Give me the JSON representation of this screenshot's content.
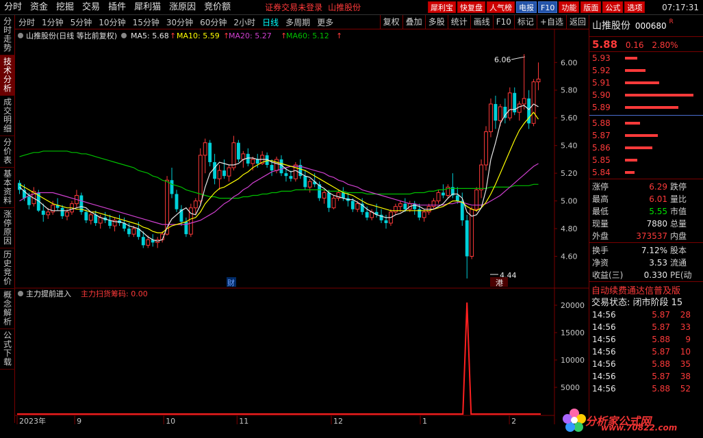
{
  "menu": [
    "分时",
    "资金",
    "挖掘",
    "交易",
    "插件",
    "犀利猫",
    "涨原因",
    "竞价额"
  ],
  "login_status": "证券交易未登录",
  "menu_stock": "山推股份",
  "top_buttons": [
    {
      "label": "犀利宝",
      "color": "red"
    },
    {
      "label": "快复盘",
      "color": "red"
    },
    {
      "label": "人气榜",
      "color": "red"
    },
    {
      "label": "电报",
      "color": "blue"
    },
    {
      "label": "F10",
      "color": "blue"
    },
    {
      "label": "功能",
      "color": "red"
    },
    {
      "label": "版面",
      "color": "red"
    },
    {
      "label": "公式",
      "color": "red"
    },
    {
      "label": "选项",
      "color": "red"
    }
  ],
  "clock": "07:17:31",
  "left_tabs": [
    "分时走势",
    "技术分析",
    "成交明细",
    "分价表",
    "基本资料",
    "涨停原因",
    "历史竞价",
    "概念解析",
    "公式下载"
  ],
  "active_left_tab": 1,
  "periods": [
    "分时",
    "1分钟",
    "5分钟",
    "10分钟",
    "15分钟",
    "30分钟",
    "60分钟",
    "2小时",
    "日线",
    "多周期",
    "更多"
  ],
  "active_period": 8,
  "tools": [
    "复权",
    "叠加",
    "多股",
    "统计",
    "画线",
    "F10",
    "标记",
    "+自选",
    "返回"
  ],
  "chart_header": {
    "title": "山推股份(日线 等比前复权)",
    "ma5": "MA5: 5.68",
    "ma10": "MA10: 5.59",
    "ma20": "MA20: 5.27",
    "ma60": "MA60: 5.12",
    "arrow": "↑"
  },
  "indicator_header": {
    "name": "主力提前进入",
    "sub": "主力扫货筹码: 0.00"
  },
  "annotations": {
    "high": "6.06",
    "low": "4.44",
    "marker1": "财",
    "marker2": "港"
  },
  "colors": {
    "up": "#ff3a3a",
    "down": "#00d0d8",
    "ma5": "#e8e8e8",
    "ma10": "#ffff00",
    "ma20": "#d040d0",
    "ma60": "#00c000",
    "frame": "#7a0000"
  },
  "chart_data": {
    "type": "candlestick",
    "price_axis": [
      "6.00",
      "5.80",
      "5.60",
      "5.40",
      "5.20",
      "5.00",
      "4.80",
      "4.60"
    ],
    "price_range": [
      4.4,
      6.12
    ],
    "volume_axis": [
      "20000",
      "15000",
      "10000",
      "5000"
    ],
    "volume_range": [
      0,
      21000
    ],
    "x_labels": [
      "2023年",
      "9",
      "10",
      "11",
      "12",
      "1",
      "2"
    ],
    "candles": [
      [
        5.13,
        5.15,
        5.05,
        5.08
      ],
      [
        5.08,
        5.12,
        5.0,
        5.02
      ],
      [
        5.03,
        5.06,
        4.94,
        4.97
      ],
      [
        4.98,
        5.1,
        4.96,
        5.07
      ],
      [
        5.06,
        5.08,
        4.92,
        4.93
      ],
      [
        4.93,
        4.98,
        4.85,
        4.9
      ],
      [
        4.9,
        4.95,
        4.87,
        4.92
      ],
      [
        4.92,
        5.0,
        4.9,
        4.97
      ],
      [
        4.97,
        5.02,
        4.93,
        4.95
      ],
      [
        4.95,
        4.97,
        4.87,
        4.89
      ],
      [
        4.89,
        4.94,
        4.86,
        4.92
      ],
      [
        4.92,
        5.0,
        4.9,
        4.98
      ],
      [
        4.98,
        5.08,
        4.95,
        5.04
      ],
      [
        5.04,
        5.06,
        4.9,
        4.92
      ],
      [
        4.92,
        4.94,
        4.84,
        4.86
      ],
      [
        4.86,
        4.92,
        4.83,
        4.9
      ],
      [
        4.9,
        4.93,
        4.82,
        4.84
      ],
      [
        4.84,
        4.9,
        4.8,
        4.88
      ],
      [
        4.88,
        4.92,
        4.84,
        4.86
      ],
      [
        4.86,
        4.9,
        4.8,
        4.82
      ],
      [
        4.82,
        4.88,
        4.78,
        4.86
      ],
      [
        4.86,
        4.9,
        4.82,
        4.84
      ],
      [
        4.84,
        4.88,
        4.78,
        4.8
      ],
      [
        4.8,
        4.84,
        4.74,
        4.76
      ],
      [
        4.76,
        4.82,
        4.74,
        4.8
      ],
      [
        4.8,
        4.85,
        4.72,
        4.74
      ],
      [
        4.74,
        4.78,
        4.66,
        4.68
      ],
      [
        4.68,
        4.75,
        4.66,
        4.72
      ],
      [
        4.72,
        4.76,
        4.67,
        4.7
      ],
      [
        4.7,
        4.74,
        4.66,
        4.72
      ],
      [
        4.72,
        4.78,
        4.7,
        4.76
      ],
      [
        4.76,
        5.18,
        4.75,
        5.15
      ],
      [
        5.15,
        5.24,
        5.02,
        5.05
      ],
      [
        5.05,
        5.08,
        4.92,
        4.94
      ],
      [
        4.94,
        4.97,
        4.82,
        4.85
      ],
      [
        4.85,
        4.88,
        4.74,
        4.76
      ],
      [
        4.76,
        4.98,
        4.74,
        4.95
      ],
      [
        4.95,
        5.02,
        4.9,
        5.0
      ],
      [
        5.0,
        5.38,
        4.98,
        5.33
      ],
      [
        5.33,
        5.45,
        5.2,
        5.42
      ],
      [
        5.42,
        5.44,
        5.25,
        5.28
      ],
      [
        5.28,
        5.34,
        5.12,
        5.16
      ],
      [
        5.16,
        5.26,
        5.08,
        5.22
      ],
      [
        5.22,
        5.3,
        5.16,
        5.18
      ],
      [
        5.18,
        5.26,
        5.14,
        5.24
      ],
      [
        5.24,
        5.47,
        5.22,
        5.42
      ],
      [
        5.42,
        5.44,
        5.28,
        5.3
      ],
      [
        5.3,
        5.36,
        5.24,
        5.34
      ],
      [
        5.34,
        5.38,
        5.25,
        5.27
      ],
      [
        5.27,
        5.32,
        5.22,
        5.3
      ],
      [
        5.3,
        5.34,
        5.24,
        5.27
      ],
      [
        5.27,
        5.36,
        5.26,
        5.33
      ],
      [
        5.33,
        5.35,
        5.24,
        5.26
      ],
      [
        5.26,
        5.3,
        5.18,
        5.22
      ],
      [
        5.22,
        5.32,
        5.2,
        5.3
      ],
      [
        5.3,
        5.33,
        5.18,
        5.2
      ],
      [
        5.2,
        5.24,
        5.14,
        5.18
      ],
      [
        5.18,
        5.22,
        5.14,
        5.16
      ],
      [
        5.16,
        5.28,
        5.14,
        5.26
      ],
      [
        5.26,
        5.3,
        5.16,
        5.18
      ],
      [
        5.18,
        5.22,
        5.08,
        5.1
      ],
      [
        5.1,
        5.16,
        5.06,
        5.14
      ],
      [
        5.14,
        5.2,
        5.1,
        5.12
      ],
      [
        5.12,
        5.14,
        5.0,
        5.02
      ],
      [
        5.02,
        5.08,
        4.98,
        5.06
      ],
      [
        5.06,
        5.08,
        4.92,
        4.95
      ],
      [
        4.95,
        5.04,
        4.94,
        5.02
      ],
      [
        5.02,
        5.08,
        5.0,
        5.06
      ],
      [
        5.06,
        5.1,
        5.0,
        5.02
      ],
      [
        5.02,
        5.06,
        4.96,
        5.0
      ],
      [
        5.0,
        5.02,
        4.92,
        4.94
      ],
      [
        4.94,
        5.0,
        4.92,
        4.98
      ],
      [
        4.98,
        5.02,
        4.9,
        4.92
      ],
      [
        4.92,
        4.96,
        4.86,
        4.88
      ],
      [
        4.88,
        4.94,
        4.86,
        4.92
      ],
      [
        4.92,
        4.98,
        4.88,
        4.9
      ],
      [
        4.9,
        4.94,
        4.84,
        4.86
      ],
      [
        4.86,
        4.9,
        4.8,
        4.84
      ],
      [
        4.84,
        4.94,
        4.82,
        4.92
      ],
      [
        4.92,
        4.98,
        4.9,
        4.96
      ],
      [
        4.96,
        5.0,
        4.92,
        4.98
      ],
      [
        4.98,
        5.02,
        4.92,
        4.94
      ],
      [
        4.94,
        5.0,
        4.92,
        4.98
      ],
      [
        4.98,
        5.0,
        4.9,
        4.94
      ],
      [
        4.94,
        4.98,
        4.86,
        4.88
      ],
      [
        4.88,
        4.94,
        4.85,
        4.92
      ],
      [
        4.92,
        4.98,
        4.9,
        4.96
      ],
      [
        4.96,
        5.02,
        4.94,
        5.0
      ],
      [
        5.0,
        5.08,
        4.98,
        5.06
      ],
      [
        5.06,
        5.12,
        5.02,
        5.04
      ],
      [
        5.04,
        5.12,
        5.02,
        5.1
      ],
      [
        5.1,
        5.2,
        5.02,
        5.04
      ],
      [
        5.04,
        5.1,
        4.98,
        5.0
      ],
      [
        5.0,
        5.06,
        4.82,
        4.86
      ],
      [
        4.86,
        4.9,
        4.44,
        4.6
      ],
      [
        4.6,
        4.96,
        4.58,
        4.94
      ],
      [
        4.94,
        5.1,
        4.92,
        5.08
      ],
      [
        5.08,
        5.3,
        5.02,
        5.26
      ],
      [
        5.26,
        5.54,
        5.22,
        5.5
      ],
      [
        5.5,
        5.74,
        5.46,
        5.7
      ],
      [
        5.7,
        5.76,
        5.52,
        5.58
      ],
      [
        5.58,
        5.7,
        5.54,
        5.68
      ],
      [
        5.68,
        5.74,
        5.56,
        5.6
      ],
      [
        5.6,
        5.82,
        5.58,
        5.78
      ],
      [
        5.78,
        5.82,
        5.62,
        5.64
      ],
      [
        5.64,
        5.72,
        5.58,
        5.7
      ],
      [
        5.7,
        6.06,
        5.66,
        5.74
      ],
      [
        5.74,
        5.8,
        5.52,
        5.56
      ],
      [
        5.56,
        5.88,
        5.54,
        5.86
      ],
      [
        5.86,
        6.0,
        5.8,
        5.88
      ]
    ],
    "ma5": [
      5.1,
      5.07,
      5.04,
      5.02,
      5.0,
      4.97,
      4.94,
      4.93,
      4.93,
      4.93,
      4.93,
      4.94,
      4.95,
      4.96,
      4.95,
      4.92,
      4.9,
      4.88,
      4.87,
      4.86,
      4.85,
      4.85,
      4.84,
      4.82,
      4.81,
      4.8,
      4.77,
      4.74,
      4.72,
      4.71,
      4.72,
      4.81,
      4.87,
      4.9,
      4.93,
      4.95,
      4.91,
      4.9,
      4.97,
      5.1,
      5.2,
      5.24,
      5.28,
      5.27,
      5.26,
      5.26,
      5.27,
      5.3,
      5.31,
      5.31,
      5.3,
      5.3,
      5.3,
      5.28,
      5.27,
      5.26,
      5.23,
      5.21,
      5.22,
      5.2,
      5.18,
      5.17,
      5.14,
      5.11,
      5.09,
      5.06,
      5.04,
      5.03,
      5.02,
      5.01,
      5.01,
      4.99,
      4.97,
      4.94,
      4.92,
      4.9,
      4.89,
      4.88,
      4.88,
      4.9,
      4.91,
      4.93,
      4.96,
      4.97,
      4.96,
      4.94,
      4.94,
      4.94,
      4.96,
      4.98,
      5.02,
      5.05,
      5.05,
      5.02,
      4.92,
      4.89,
      4.9,
      4.95,
      5.08,
      5.3,
      5.42,
      5.56,
      5.62,
      5.66,
      5.66,
      5.68,
      5.69,
      5.66,
      5.7,
      5.68
    ],
    "ma10": [
      5.12,
      5.1,
      5.08,
      5.06,
      5.04,
      5.02,
      5.0,
      4.98,
      4.97,
      4.96,
      4.95,
      4.95,
      4.94,
      4.94,
      4.93,
      4.92,
      4.92,
      4.91,
      4.9,
      4.89,
      4.88,
      4.87,
      4.86,
      4.85,
      4.84,
      4.83,
      4.81,
      4.8,
      4.78,
      4.77,
      4.77,
      4.8,
      4.82,
      4.83,
      4.84,
      4.85,
      4.87,
      4.88,
      4.92,
      4.98,
      5.02,
      5.06,
      5.09,
      5.1,
      5.12,
      5.14,
      5.16,
      5.19,
      5.21,
      5.24,
      5.26,
      5.28,
      5.29,
      5.29,
      5.28,
      5.27,
      5.26,
      5.25,
      5.24,
      5.23,
      5.22,
      5.2,
      5.18,
      5.16,
      5.14,
      5.12,
      5.1,
      5.08,
      5.06,
      5.05,
      5.04,
      5.02,
      5.0,
      4.98,
      4.97,
      4.96,
      4.95,
      4.94,
      4.93,
      4.93,
      4.93,
      4.93,
      4.93,
      4.93,
      4.93,
      4.93,
      4.93,
      4.94,
      4.95,
      4.96,
      4.98,
      5.0,
      5.0,
      4.99,
      4.96,
      4.94,
      4.93,
      4.95,
      4.99,
      5.05,
      5.12,
      5.2,
      5.28,
      5.36,
      5.44,
      5.51,
      5.56,
      5.6,
      5.64,
      5.59
    ],
    "ma20": [
      5.0,
      5.02,
      5.04,
      5.05,
      5.06,
      5.06,
      5.06,
      5.06,
      5.05,
      5.04,
      5.03,
      5.02,
      5.01,
      5.0,
      4.99,
      4.98,
      4.97,
      4.96,
      4.95,
      4.94,
      4.93,
      4.92,
      4.91,
      4.9,
      4.89,
      4.88,
      4.87,
      4.86,
      4.85,
      4.84,
      4.83,
      4.83,
      4.83,
      4.83,
      4.83,
      4.83,
      4.84,
      4.85,
      4.86,
      4.88,
      4.9,
      4.92,
      4.95,
      4.98,
      5.0,
      5.03,
      5.05,
      5.08,
      5.1,
      5.13,
      5.15,
      5.17,
      5.19,
      5.21,
      5.22,
      5.23,
      5.24,
      5.25,
      5.25,
      5.25,
      5.24,
      5.23,
      5.22,
      5.21,
      5.2,
      5.18,
      5.17,
      5.15,
      5.14,
      5.12,
      5.11,
      5.1,
      5.08,
      5.07,
      5.06,
      5.05,
      5.04,
      5.03,
      5.02,
      5.01,
      5.0,
      4.99,
      4.98,
      4.98,
      4.97,
      4.97,
      4.97,
      4.97,
      4.97,
      4.97,
      4.98,
      4.98,
      4.99,
      4.99,
      4.98,
      4.97,
      4.97,
      4.97,
      4.98,
      5.0,
      5.02,
      5.04,
      5.07,
      5.1,
      5.13,
      5.16,
      5.19,
      5.22,
      5.25,
      5.27
    ],
    "ma60": [
      5.32,
      5.33,
      5.34,
      5.35,
      5.35,
      5.36,
      5.36,
      5.36,
      5.36,
      5.36,
      5.36,
      5.35,
      5.35,
      5.34,
      5.34,
      5.33,
      5.32,
      5.31,
      5.3,
      5.29,
      5.28,
      5.27,
      5.26,
      5.25,
      5.24,
      5.22,
      5.21,
      5.2,
      5.18,
      5.17,
      5.15,
      5.14,
      5.12,
      5.11,
      5.1,
      5.08,
      5.07,
      5.06,
      5.05,
      5.04,
      5.03,
      5.03,
      5.02,
      5.02,
      5.02,
      5.02,
      5.02,
      5.03,
      5.03,
      5.04,
      5.04,
      5.05,
      5.05,
      5.06,
      5.06,
      5.07,
      5.07,
      5.07,
      5.08,
      5.08,
      5.08,
      5.08,
      5.08,
      5.08,
      5.08,
      5.07,
      5.07,
      5.07,
      5.07,
      5.06,
      5.06,
      5.06,
      5.06,
      5.05,
      5.05,
      5.05,
      5.05,
      5.05,
      5.05,
      5.05,
      5.05,
      5.05,
      5.05,
      5.06,
      5.06,
      5.06,
      5.07,
      5.07,
      5.08,
      5.08,
      5.09,
      5.09,
      5.09,
      5.09,
      5.09,
      5.09,
      5.09,
      5.09,
      5.09,
      5.1,
      5.1,
      5.1,
      5.1,
      5.1,
      5.11,
      5.11,
      5.11,
      5.11,
      5.12,
      5.12
    ],
    "volume_spike": {
      "index": 94,
      "value": 20500
    }
  },
  "stock": {
    "name": "山推股份",
    "code": "000680",
    "r": "R",
    "price": "5.88",
    "chg": "0.16",
    "pct": "2.80%"
  },
  "asks": [
    {
      "price": "5.93",
      "bar": 18
    },
    {
      "price": "5.92",
      "bar": 30
    },
    {
      "price": "5.91",
      "bar": 50
    },
    {
      "price": "5.90",
      "bar": 100
    },
    {
      "price": "5.89",
      "bar": 78
    }
  ],
  "bids": [
    {
      "price": "5.88",
      "bar": 22
    },
    {
      "price": "5.87",
      "bar": 48
    },
    {
      "price": "5.86",
      "bar": 40
    },
    {
      "price": "5.85",
      "bar": 18
    },
    {
      "price": "5.84",
      "bar": 14
    }
  ],
  "stats1": [
    {
      "label": "涨停",
      "val": "6.29",
      "vcls": "red",
      "r": "跌停"
    },
    {
      "label": "最高",
      "val": "6.01",
      "vcls": "red",
      "r": "量比"
    },
    {
      "label": "最低",
      "val": "5.55",
      "vcls": "green",
      "r": "市值"
    },
    {
      "label": "现量",
      "val": "7880",
      "vcls": "white",
      "r": "总量"
    },
    {
      "label": "外盘",
      "val": "373537",
      "vcls": "red",
      "r": "内盘"
    }
  ],
  "stats2": [
    {
      "label": "换手",
      "val": "7.12%",
      "vcls": "white",
      "r": "股本"
    },
    {
      "label": "净资",
      "val": "3.53",
      "vcls": "white",
      "r": "流通"
    },
    {
      "label": "收益(三)",
      "val": "0.330",
      "vcls": "white",
      "r": "PE(动"
    }
  ],
  "scroll_text": "自动续费通达信普及版",
  "trade_status": "交易状态: 闭市阶段 15",
  "ticks": [
    {
      "time": "14:56",
      "price": "5.87",
      "vol": "28"
    },
    {
      "time": "14:56",
      "price": "5.87",
      "vol": "33"
    },
    {
      "time": "14:56",
      "price": "5.88",
      "vol": "9"
    },
    {
      "time": "14:56",
      "price": "5.87",
      "vol": "10"
    },
    {
      "time": "14:56",
      "price": "5.88",
      "vol": "35"
    },
    {
      "time": "14:56",
      "price": "5.87",
      "vol": "38"
    },
    {
      "time": "14:56",
      "price": "5.88",
      "vol": "52"
    }
  ],
  "logo": {
    "main": "分析家公式网",
    "sub": "www.70822.com"
  }
}
